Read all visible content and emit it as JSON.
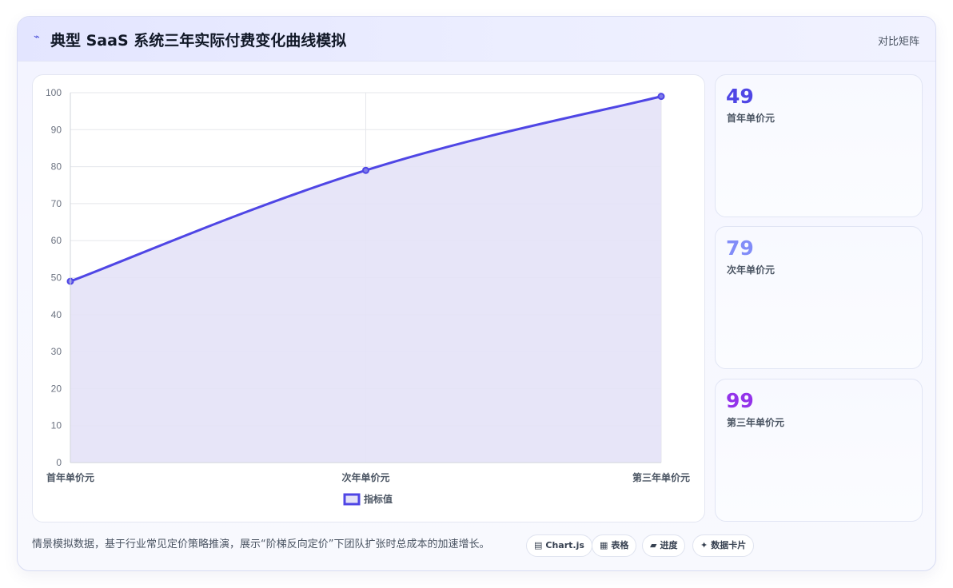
{
  "header": {
    "icon": "sparkle-icon",
    "title": "典型 SaaS 系统三年实际付费变化曲线模拟",
    "right_label": "对比矩阵"
  },
  "chart_data": {
    "type": "line",
    "fill": true,
    "categories": [
      "首年单价元",
      "次年单价元",
      "第三年单价元"
    ],
    "series": [
      {
        "name": "指标值",
        "values": [
          49,
          79,
          99
        ],
        "color": "#4f46e5",
        "fill_color": "#e4e2f7"
      }
    ],
    "ylim": [
      0,
      100
    ],
    "yticks": [
      0,
      10,
      20,
      30,
      40,
      50,
      60,
      70,
      80,
      90,
      100
    ],
    "grid": true,
    "legend": "bottom-center"
  },
  "stats": [
    {
      "value": "49",
      "label": "首年单价元",
      "color": "#4f46e5"
    },
    {
      "value": "79",
      "label": "次年单价元",
      "color": "#818cf8"
    },
    {
      "value": "99",
      "label": "第三年单价元",
      "color": "#9333ea"
    }
  ],
  "footer": {
    "note": "情景模拟数据，基于行业常见定价策略推演，展示“阶梯反向定价”下团队扩张时总成本的加速增长。",
    "chips": [
      {
        "icon": "chart-icon",
        "glyph": "▤",
        "label": "Chart.js"
      },
      {
        "icon": "table-icon",
        "glyph": "▦",
        "label": "表格"
      },
      {
        "icon": "progress-icon",
        "glyph": "▰",
        "label": "进度"
      },
      {
        "icon": "card-icon",
        "glyph": "✦",
        "label": "数据卡片"
      }
    ]
  }
}
